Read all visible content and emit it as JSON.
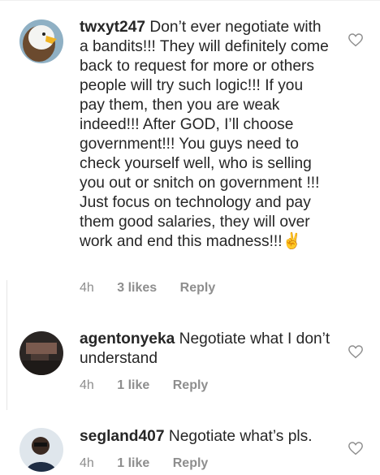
{
  "comments": [
    {
      "username": "twxyt247",
      "text": "Don’t ever negotiate with a bandits!!! They will definitely come back to request for more or others people will try such logic!!! If you pay them, then you are weak indeed!!! After GOD, I’ll choose government!!! You guys need to check yourself well, who is selling you out or snitch on government !!! Just focus on technology and pay them good salaries, they will over work and end this madness!!!✌️",
      "time": "4h",
      "likes": "3 likes",
      "reply": "Reply",
      "avatar_icon": "eagle-avatar"
    },
    {
      "username": "agentonyeka",
      "text": "Negotiate what I don’t understand",
      "time": "4h",
      "likes": "1 like",
      "reply": "Reply",
      "avatar_icon": "room-avatar"
    },
    {
      "username": "segland407",
      "text": "Negotiate what’s pls.",
      "time": "4h",
      "likes": "1 like",
      "reply": "Reply",
      "avatar_icon": "person-avatar"
    }
  ],
  "colors": {
    "text": "#262626",
    "meta": "#8e8e8e"
  }
}
